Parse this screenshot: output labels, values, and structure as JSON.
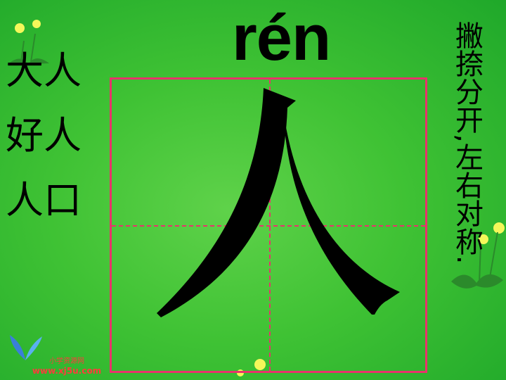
{
  "pinyin": "rén",
  "words": [
    "大人",
    "好人",
    "人口"
  ],
  "tip": "撇捺分开,左右对称.",
  "footer": {
    "site_name": "小学资源网",
    "site_url": "www.xj5u.com"
  },
  "colors": {
    "background": "#3fc234",
    "grid_line": "#e8336b",
    "footer_text": "#ff3b3b"
  },
  "icons": [
    "dandelion-decoration",
    "leaf-logo-icon"
  ]
}
